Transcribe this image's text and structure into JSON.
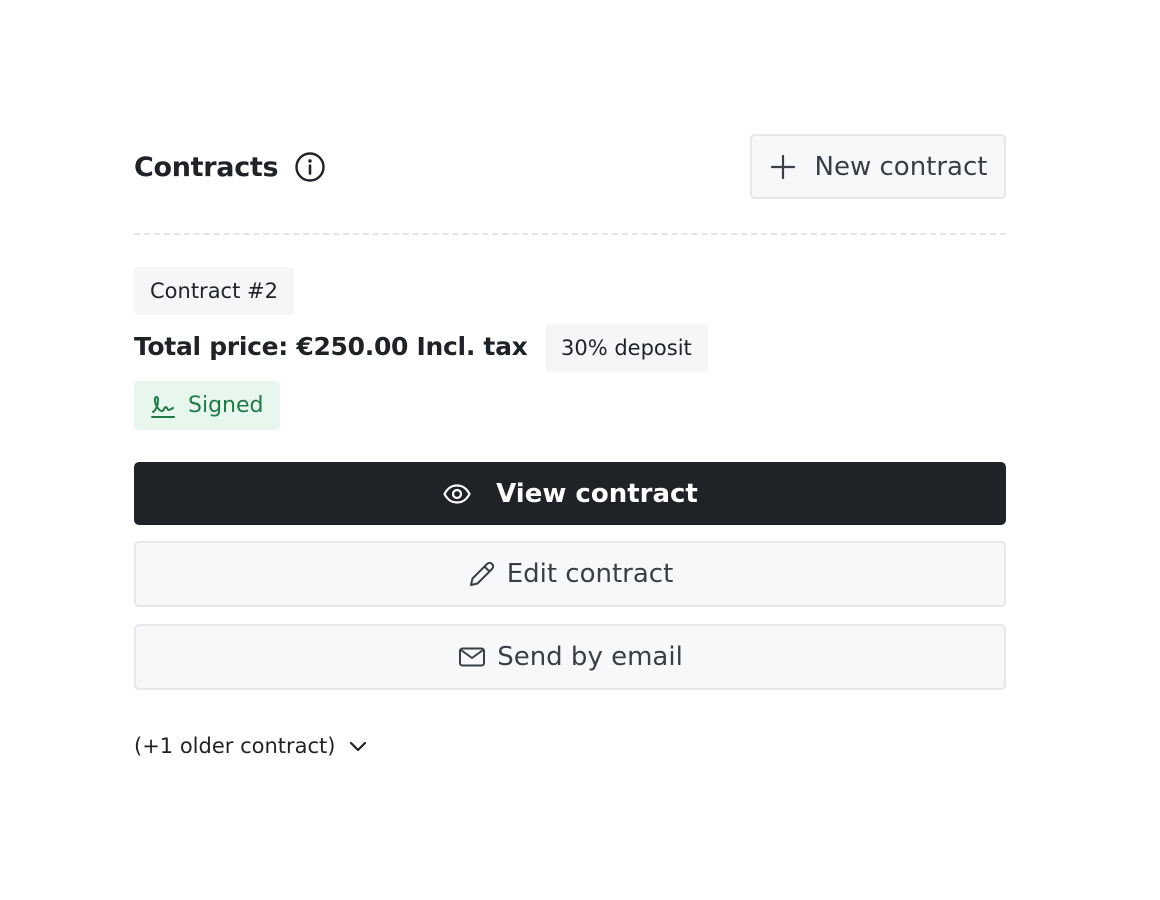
{
  "header": {
    "title": "Contracts",
    "info_icon": "info-circle-icon",
    "new_contract_label": "New contract",
    "new_contract_icon": "plus-icon"
  },
  "contract": {
    "number_label": "Contract #2",
    "total_price": "Total price: €250.00 Incl. tax",
    "deposit": "30% deposit",
    "status": {
      "label": "Signed",
      "icon": "signature-icon",
      "color": "#1f7a46",
      "background": "#e8f7ed"
    }
  },
  "actions": {
    "view_label": "View contract",
    "view_icon": "eye-icon",
    "edit_label": "Edit contract",
    "edit_icon": "pencil-icon",
    "send_label": "Send by email",
    "send_icon": "envelope-icon"
  },
  "older": {
    "label": "(+1 older contract)",
    "icon": "chevron-down-icon"
  },
  "colors": {
    "primary_button": "#1f2328",
    "secondary_button": "#f7f8fa",
    "text": "#1f2328"
  }
}
